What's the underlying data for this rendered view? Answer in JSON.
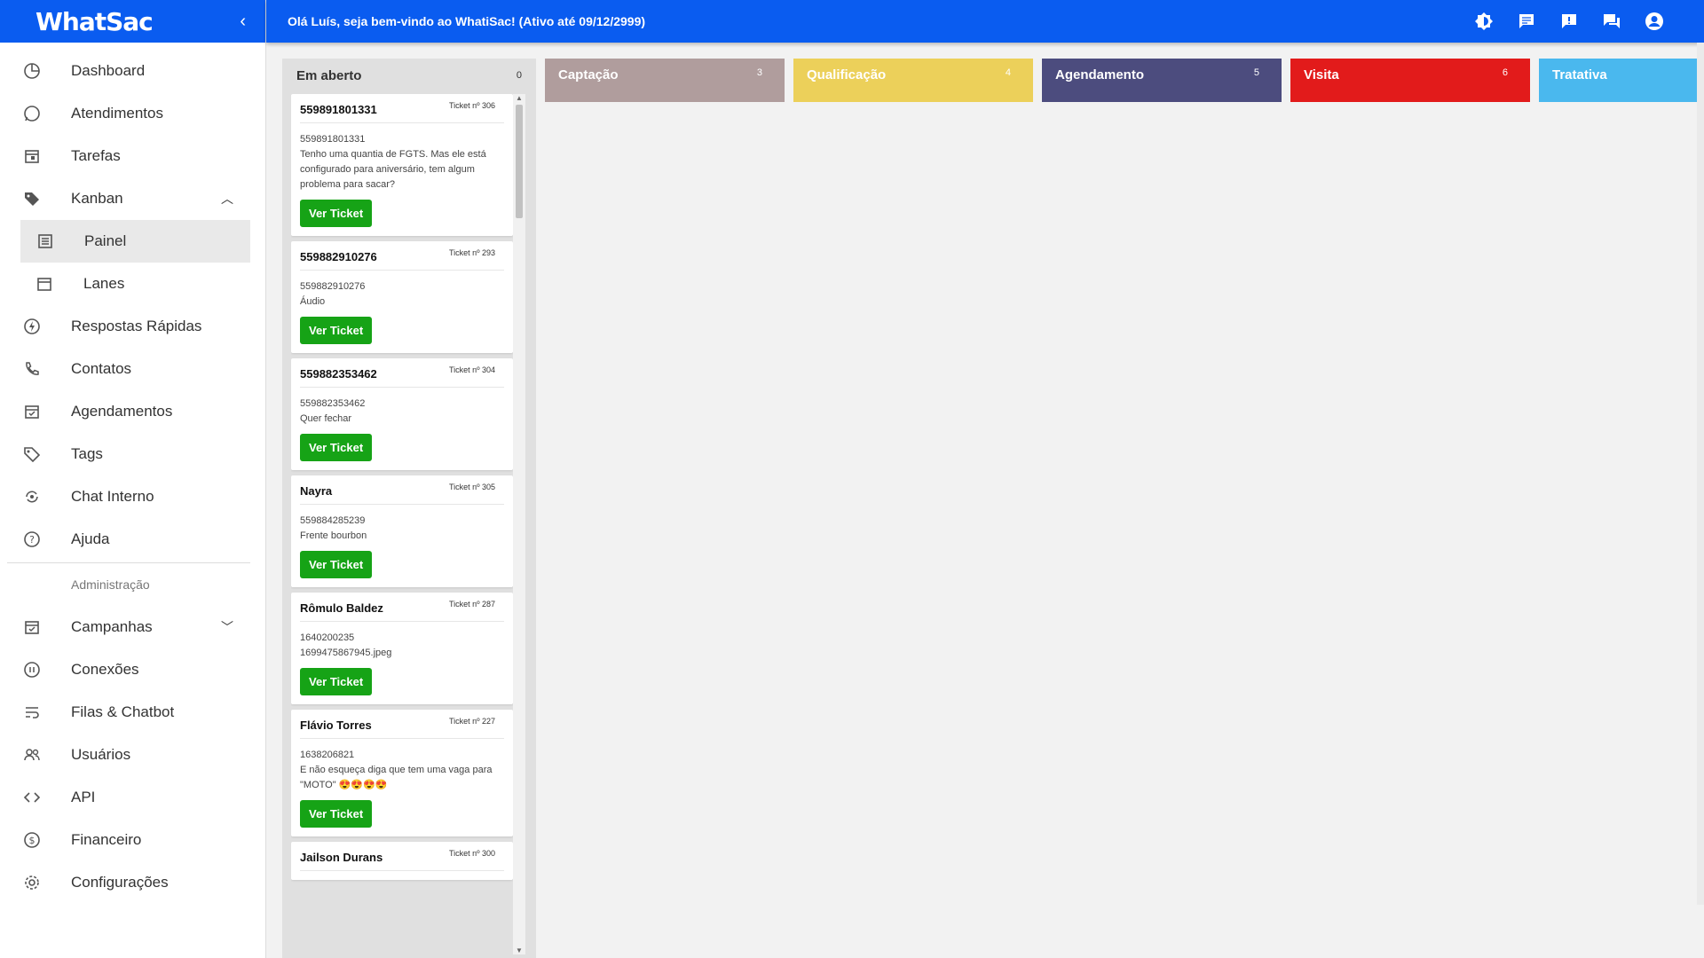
{
  "sidebar": {
    "logo": "WhatSac",
    "items": [
      {
        "label": "Dashboard"
      },
      {
        "label": "Atendimentos"
      },
      {
        "label": "Tarefas"
      },
      {
        "label": "Kanban"
      },
      {
        "label": "Painel"
      },
      {
        "label": "Lanes"
      },
      {
        "label": "Respostas Rápidas"
      },
      {
        "label": "Contatos"
      },
      {
        "label": "Agendamentos"
      },
      {
        "label": "Tags"
      },
      {
        "label": "Chat Interno"
      },
      {
        "label": "Ajuda"
      }
    ],
    "section": "Administração",
    "admin_items": [
      {
        "label": "Campanhas"
      },
      {
        "label": "Conexões"
      },
      {
        "label": "Filas & Chatbot"
      },
      {
        "label": "Usuários"
      },
      {
        "label": "API"
      },
      {
        "label": "Financeiro"
      },
      {
        "label": "Configurações"
      }
    ]
  },
  "topbar": {
    "welcome": "Olá Luís, seja bem-vindo ao WhatiSac! (Ativo até 09/12/2999)"
  },
  "open_lane": {
    "title": "Em aberto",
    "count": "0",
    "button_label": "Ver Ticket",
    "cards": [
      {
        "title": "559891801331",
        "ticket": "Ticket nº 306",
        "line1": "559891801331",
        "line2": "Tenho uma quantia de FGTS.  Mas ele está configurado para aniversário,  tem algum problema para sacar?"
      },
      {
        "title": "559882910276",
        "ticket": "Ticket nº 293",
        "line1": "559882910276",
        "line2": "Áudio"
      },
      {
        "title": "559882353462",
        "ticket": "Ticket nº 304",
        "line1": "559882353462",
        "line2": "Quer fechar"
      },
      {
        "title": "Nayra",
        "ticket": "Ticket nº 305",
        "line1": "559884285239",
        "line2": "Frente bourbon"
      },
      {
        "title": "Rômulo Baldez",
        "ticket": "Ticket nº 287",
        "line1": "1640200235",
        "line2": "1699475867945.jpeg"
      },
      {
        "title": "Flávio Torres",
        "ticket": "Ticket nº 227",
        "line1": "1638206821",
        "line2": "E não esqueça diga que tem uma vaga para \"MOTO\" 😍😍😍😍"
      },
      {
        "title": "Jailson Durans",
        "ticket": "Ticket nº 300",
        "line1": "",
        "line2": ""
      }
    ]
  },
  "lanes": [
    {
      "title": "Captação",
      "count": "3",
      "color": "#b09d9d"
    },
    {
      "title": "Qualificação",
      "count": "4",
      "color": "#ecd05a"
    },
    {
      "title": "Agendamento",
      "count": "5",
      "color": "#4c4c7e"
    },
    {
      "title": "Visita",
      "count": "6",
      "color": "#e21b1b"
    },
    {
      "title": "Tratativa",
      "count": "",
      "color": "#4ab8ee"
    }
  ]
}
